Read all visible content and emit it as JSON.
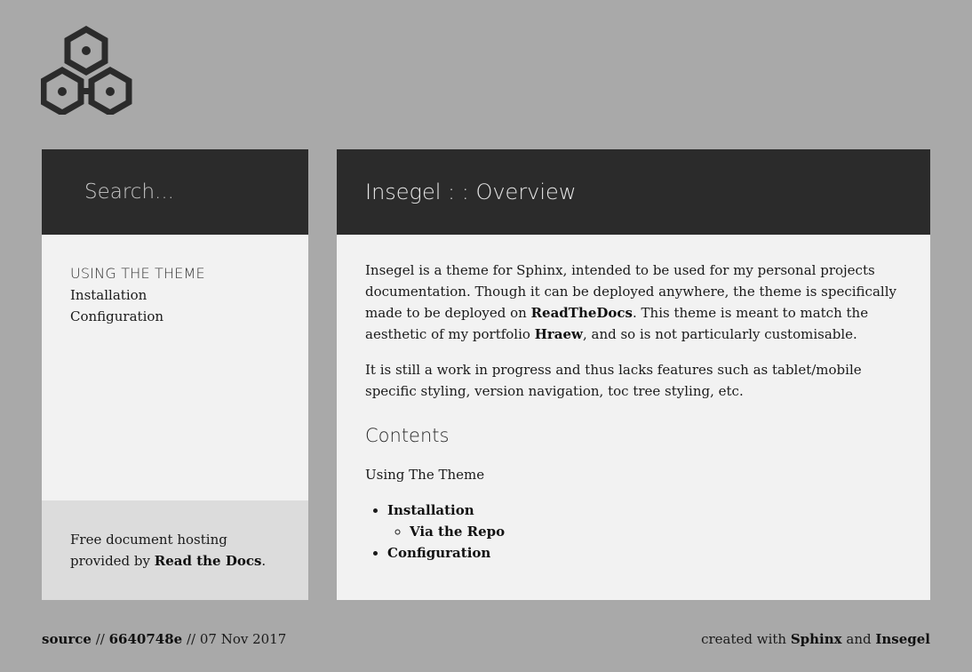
{
  "search": {
    "placeholder": "Search..."
  },
  "sidebar": {
    "toc_caption": "USING THE THEME",
    "toc_items": [
      {
        "label": "Installation"
      },
      {
        "label": "Configuration"
      }
    ],
    "hosting": {
      "text_before": "Free document hosting provided by ",
      "link": "Read the Docs",
      "text_after": "."
    }
  },
  "main": {
    "title": "Insegel : : Overview",
    "intro": {
      "part1": "Insegel is a theme for Sphinx, intended to be used for my personal projects documentation. Though it can be deployed anywhere, the theme is specifically made to be deployed on ",
      "link1": "ReadTheDocs",
      "part2": ". This theme is meant to match the aesthetic of my portfolio ",
      "link2": "Hraew",
      "part3": ", and so is not particularly customisable."
    },
    "wip": "It is still a work in progress and thus lacks features such as tablet/mobile specific styling, version navigation, toc tree styling, etc.",
    "contents_heading": "Contents",
    "contents_caption": "Using The Theme",
    "contents": {
      "installation": "Installation",
      "via_repo": "Via the Repo",
      "configuration": "Configuration"
    }
  },
  "footer": {
    "source_label": "source",
    "sep1": " // ",
    "commit": "6640748e",
    "sep2": " // ",
    "date": "07 Nov 2017",
    "created_prefix": "created with ",
    "sphinx": "Sphinx",
    "and": " and ",
    "insegel": "Insegel"
  },
  "colors": {
    "background": "#a9a9a9",
    "header_bar": "#2b2b2b",
    "panel": "#f2f2f2",
    "hosting_panel": "#dcdcdc"
  },
  "icons": {
    "logo": "hexagon-cluster-logo-icon"
  }
}
